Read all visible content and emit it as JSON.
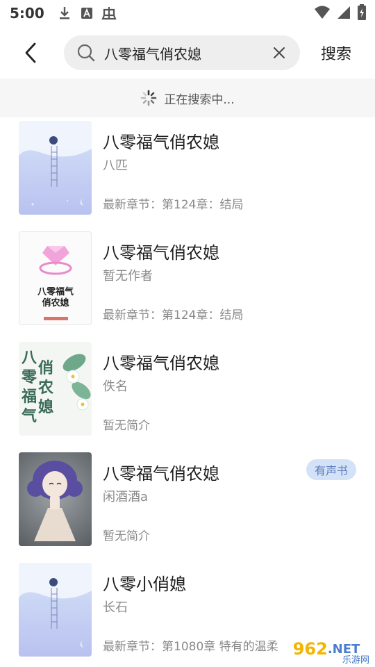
{
  "status": {
    "time": "5:00"
  },
  "header": {
    "search_query": "八零福气俏农媳",
    "search_button": "搜索"
  },
  "searching": {
    "text": "正在搜索中..."
  },
  "results": [
    {
      "title": "八零福气俏农媳",
      "author": "八匹",
      "latest": "最新章节：第124章：结局",
      "cover": "sky"
    },
    {
      "title": "八零福气俏农媳",
      "author": "暂无作者",
      "latest": "最新章节：第124章：结局",
      "cover": "ring",
      "cover_text": "八零福气\n俏农媳"
    },
    {
      "title": "八零福气俏农媳",
      "author": "佚名",
      "latest": "暂无简介",
      "cover": "flower",
      "cover_text": "八零福气俏农媳"
    },
    {
      "title": "八零福气俏农媳",
      "author": "闲酒酒a",
      "latest": "暂无简介",
      "cover": "girl",
      "tag": "有声书"
    },
    {
      "title": "八零小俏媳",
      "author": "长石",
      "latest": "最新章节：第1080章 特有的温柔",
      "cover": "sky"
    }
  ],
  "watermark": {
    "main": "962",
    "net": ".NET",
    "sub": "乐游网"
  },
  "colors": {
    "tag_bg": "#d3e2f6",
    "tag_text": "#5b7dbf",
    "search_bg": "#eeeeee"
  }
}
